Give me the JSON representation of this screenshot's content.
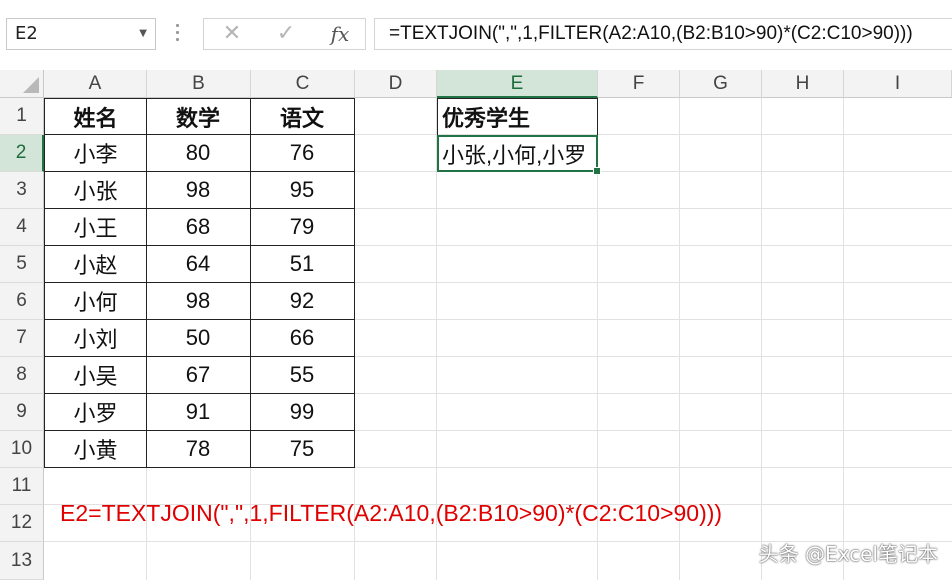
{
  "formula_bar": {
    "name_box": "E2",
    "cancel_symbol": "✕",
    "enter_symbol": "✓",
    "fx_symbol": "fx",
    "formula": "=TEXTJOIN(\",\",1,FILTER(A2:A10,(B2:B10>90)*(C2:C10>90)))"
  },
  "columns": [
    "A",
    "B",
    "C",
    "D",
    "E",
    "F",
    "G",
    "H",
    "I"
  ],
  "rows": [
    "1",
    "2",
    "3",
    "4",
    "5",
    "6",
    "7",
    "8",
    "9",
    "10",
    "11",
    "12",
    "13"
  ],
  "active_cell": "E2",
  "table": {
    "headers": [
      "姓名",
      "数学",
      "语文"
    ],
    "rows": [
      [
        "小李",
        "80",
        "76"
      ],
      [
        "小张",
        "98",
        "95"
      ],
      [
        "小王",
        "68",
        "79"
      ],
      [
        "小赵",
        "64",
        "51"
      ],
      [
        "小何",
        "98",
        "92"
      ],
      [
        "小刘",
        "50",
        "66"
      ],
      [
        "小吴",
        "67",
        "55"
      ],
      [
        "小罗",
        "91",
        "99"
      ],
      [
        "小黄",
        "78",
        "75"
      ]
    ]
  },
  "result": {
    "header": "优秀学生",
    "value": "小张,小何,小罗"
  },
  "note": "E2=TEXTJOIN(\",\",1,FILTER(A2:A10,(B2:B10>90)*(C2:C10>90)))",
  "watermark": "头条 @Excel笔记本",
  "colors": {
    "accent": "#217346",
    "note": "#e00000"
  }
}
